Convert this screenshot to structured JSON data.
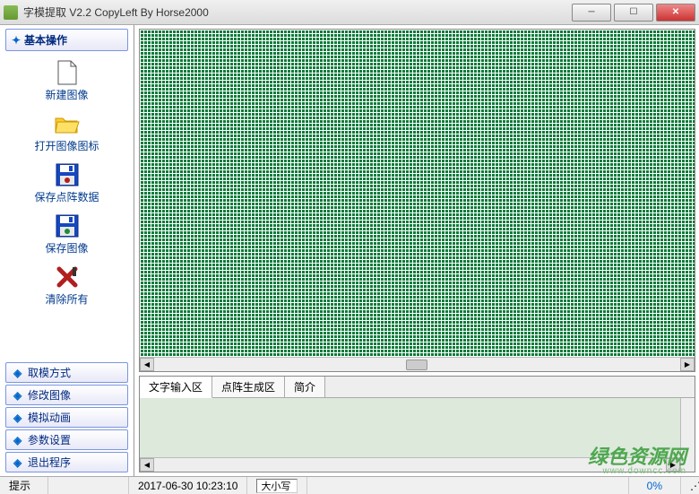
{
  "title": "字模提取 V2.2  CopyLeft By Horse2000",
  "sidebar": {
    "header": "基本操作",
    "items": [
      {
        "label": "新建图像"
      },
      {
        "label": "打开图像图标"
      },
      {
        "label": "保存点阵数据"
      },
      {
        "label": "保存图像"
      },
      {
        "label": "清除所有"
      }
    ]
  },
  "menu": {
    "items": [
      {
        "label": "取模方式"
      },
      {
        "label": "修改图像"
      },
      {
        "label": "模拟动画"
      },
      {
        "label": "参数设置"
      },
      {
        "label": "退出程序"
      }
    ]
  },
  "tabs": [
    {
      "label": "文字输入区",
      "active": true
    },
    {
      "label": "点阵生成区",
      "active": false
    },
    {
      "label": "简介",
      "active": false
    }
  ],
  "statusbar": {
    "hint": "提示",
    "datetime": "2017-06-30 10:23:10",
    "caps": "大小写",
    "percent": "0%"
  },
  "watermark": {
    "main": "绿色资源网",
    "sub": "www.downcc.com"
  }
}
